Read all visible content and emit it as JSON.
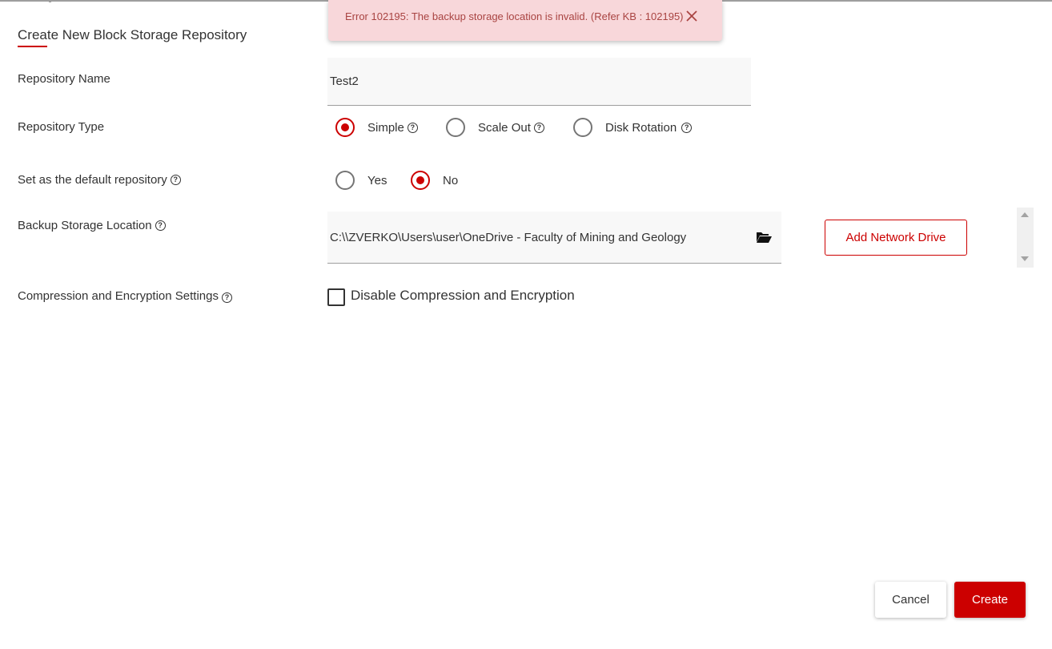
{
  "toast": {
    "message": "Error 102195: The backup storage location is invalid. (Refer KB : 102195)",
    "close_icon": "close-icon",
    "color": "#a94442",
    "background": "#f8d7da"
  },
  "title": "Create New Block Storage Repository",
  "repository_name": {
    "label": "Repository Name",
    "value": "Test2"
  },
  "repository_type": {
    "label": "Repository Type",
    "options": [
      {
        "label": "Simple",
        "selected": true
      },
      {
        "label": "Scale Out",
        "selected": false
      },
      {
        "label": "Disk Rotation",
        "selected": false
      }
    ]
  },
  "default_repository": {
    "label": "Set as the default repository",
    "options": [
      {
        "label": "Yes",
        "selected": false
      },
      {
        "label": "No",
        "selected": true
      }
    ]
  },
  "backup_location": {
    "label": "Backup Storage Location",
    "value": "C:\\\\ZVERKO\\Users\\user\\OneDrive - Faculty of Mining and Geology",
    "browse_icon": "folder-open-icon",
    "add_network_drive_label": "Add Network Drive"
  },
  "compression": {
    "label": "Compression and Encryption Settings",
    "checkbox_label": "Disable Compression and Encryption",
    "checked": false
  },
  "help_icon_glyph": "?",
  "buttons": {
    "cancel": "Cancel",
    "create": "Create"
  },
  "colors": {
    "accent": "#cc0000",
    "text": "#333333"
  }
}
